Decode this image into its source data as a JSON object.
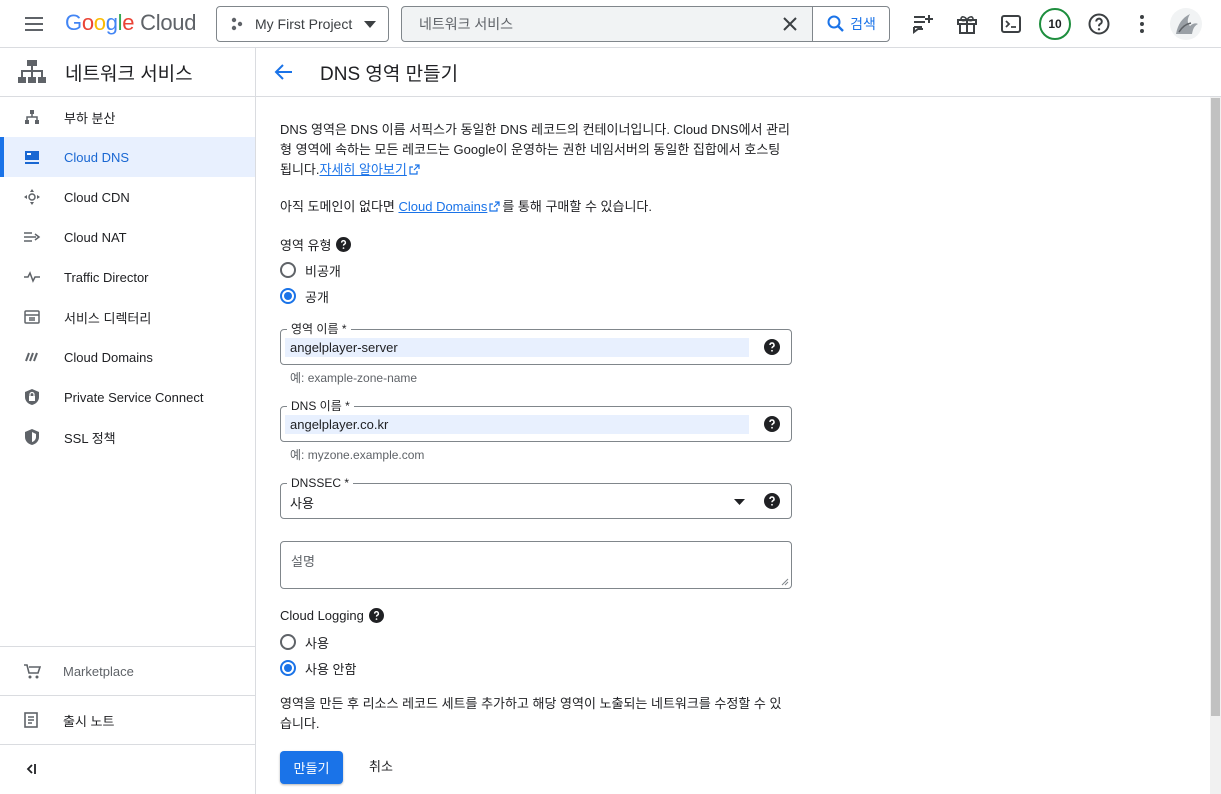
{
  "topbar": {
    "logo_parts": [
      "G",
      "o",
      "o",
      "g",
      "l",
      "e"
    ],
    "logo_cloud": "Cloud",
    "project_name": "My First Project",
    "search_value": "네트워크 서비스",
    "search_button": "검색",
    "notifications_count": "10"
  },
  "sidebar": {
    "title": "네트워크 서비스",
    "items": [
      {
        "label": "부하 분산",
        "icon": "load-balancing-icon"
      },
      {
        "label": "Cloud DNS",
        "icon": "cloud-dns-icon",
        "active": true
      },
      {
        "label": "Cloud CDN",
        "icon": "cloud-cdn-icon"
      },
      {
        "label": "Cloud NAT",
        "icon": "cloud-nat-icon"
      },
      {
        "label": "Traffic Director",
        "icon": "traffic-director-icon"
      },
      {
        "label": "서비스 디렉터리",
        "icon": "service-directory-icon"
      },
      {
        "label": "Cloud Domains",
        "icon": "cloud-domains-icon"
      },
      {
        "label": "Private Service Connect",
        "icon": "private-service-connect-icon"
      },
      {
        "label": "SSL 정책",
        "icon": "ssl-policy-icon"
      }
    ],
    "marketplace": "Marketplace",
    "release_notes": "출시 노트"
  },
  "main": {
    "title": "DNS 영역 만들기",
    "intro_text": "DNS 영역은 DNS 이름 서픽스가 동일한 DNS 레코드의 컨테이너입니다. Cloud DNS에서 관리형 영역에 속하는 모든 레코드는 Google이 운영하는 권한 네임서버의 동일한 집합에서 호스팅됩니다.",
    "learn_more": "자세히 알아보기",
    "domain_prefix": "아직 도메인이 없다면 ",
    "domain_link": "Cloud Domains",
    "domain_suffix": "를 통해 구매할 수 있습니다.",
    "zone_type_label": "영역 유형",
    "zone_type_options": [
      "비공개",
      "공개"
    ],
    "zone_type_selected": "공개",
    "zone_name_label": "영역 이름 *",
    "zone_name_value": "angelplayer-server",
    "zone_name_hint": "예: example-zone-name",
    "dns_name_label": "DNS 이름 *",
    "dns_name_value": "angelplayer.co.kr",
    "dns_name_hint": "예: myzone.example.com",
    "dnssec_label": "DNSSEC *",
    "dnssec_value": "사용",
    "description_placeholder": "설명",
    "logging_label": "Cloud Logging",
    "logging_options": [
      "사용",
      "사용 안함"
    ],
    "logging_selected": "사용 안함",
    "footer_text": "영역을 만든 후 리소스 레코드 세트를 추가하고 해당 영역이 노출되는 네트워크를 수정할 수 있습니다.",
    "create_button": "만들기",
    "cancel_button": "취소"
  },
  "colors": {
    "accent": "#1a73e8",
    "active_bg": "#e8f0fe",
    "badge_ring": "#1e8e3e"
  }
}
